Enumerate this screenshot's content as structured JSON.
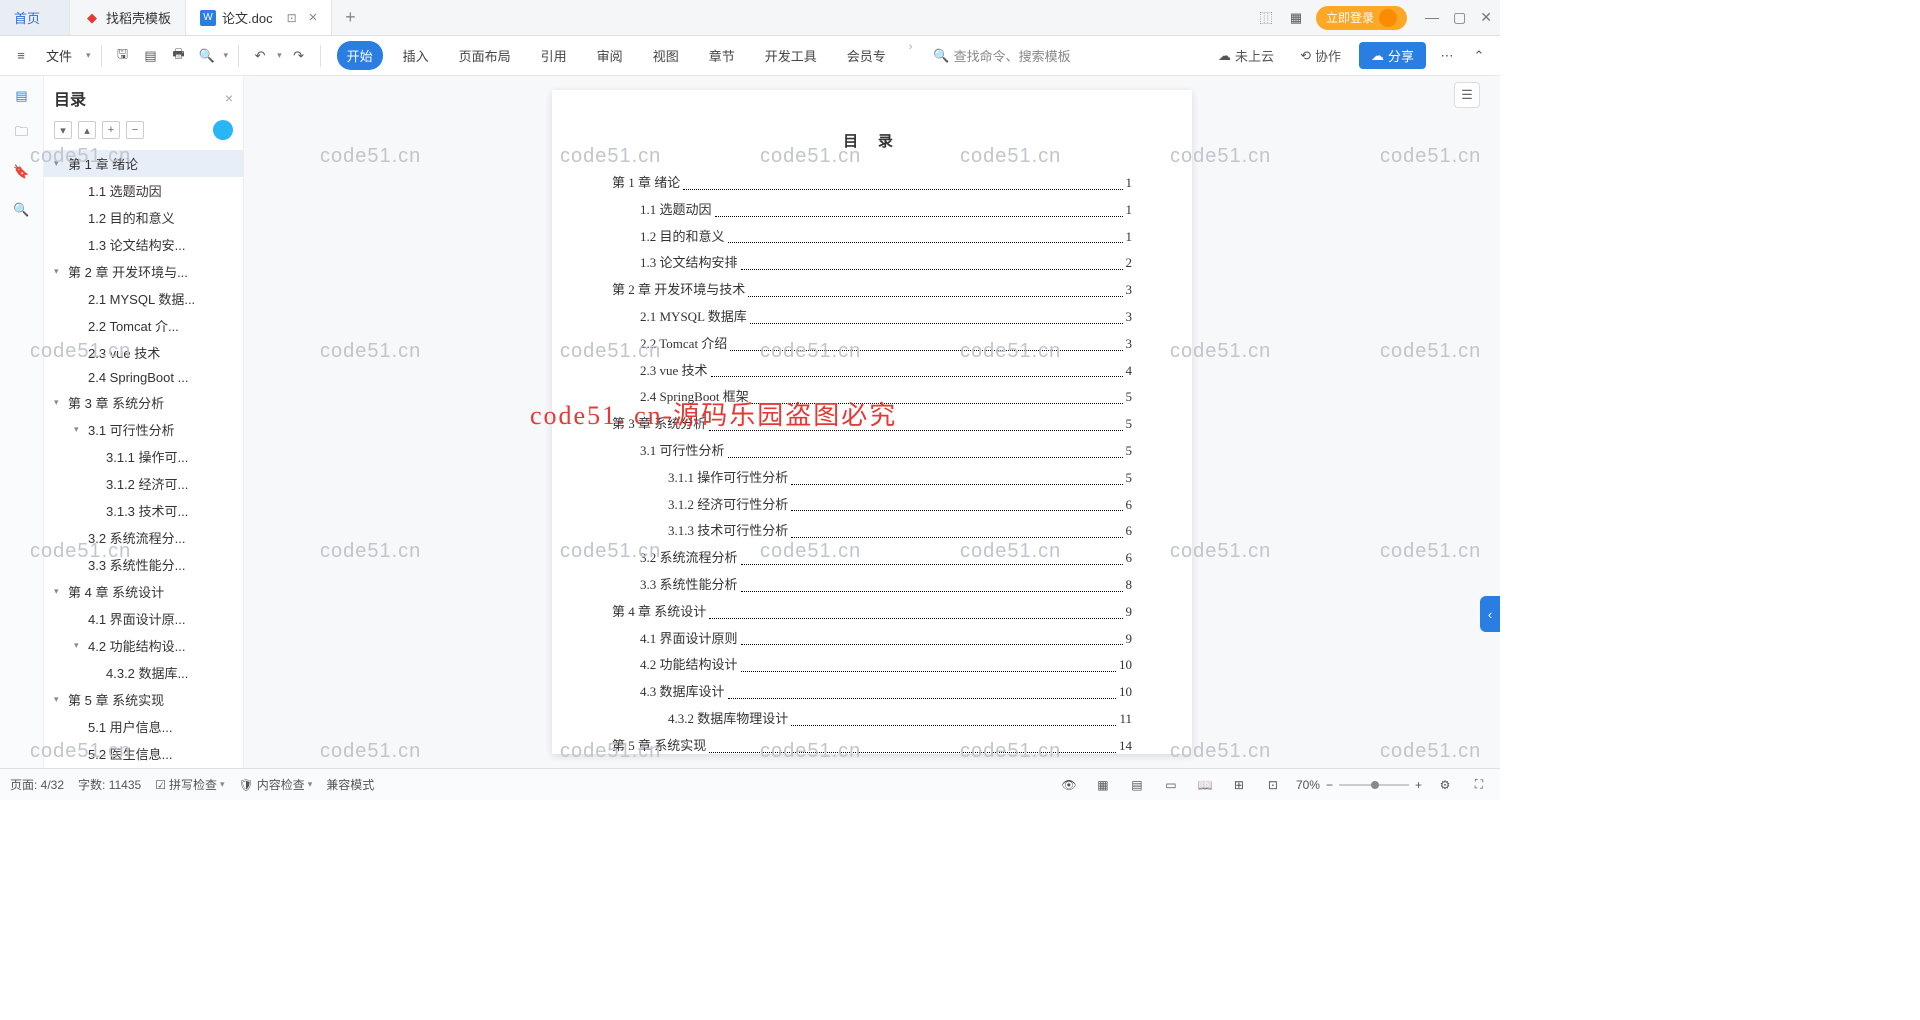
{
  "tabs": {
    "home": "首页",
    "t1": "找稻壳模板",
    "t2": "论文.doc"
  },
  "login_btn": "立即登录",
  "file_label": "文件",
  "menu": {
    "start": "开始",
    "insert": "插入",
    "layout": "页面布局",
    "ref": "引用",
    "review": "审阅",
    "view": "视图",
    "chapter": "章节",
    "devtools": "开发工具",
    "member": "会员专"
  },
  "search_cmd": "查找命令、搜索模板",
  "cloud": "未上云",
  "collab": "协作",
  "share": "分享",
  "toc_panel_title": "目录",
  "toc": [
    {
      "lvl": 0,
      "caret": "▾",
      "txt": "第 1 章  绪论",
      "sel": true
    },
    {
      "lvl": 1,
      "txt": "1.1 选题动因"
    },
    {
      "lvl": 1,
      "txt": "1.2 目的和意义"
    },
    {
      "lvl": 1,
      "txt": "1.3 论文结构安..."
    },
    {
      "lvl": 0,
      "caret": "▾",
      "txt": "第 2 章  开发环境与..."
    },
    {
      "lvl": 1,
      "txt": "2.1 MYSQL 数据..."
    },
    {
      "lvl": 1,
      "txt": "2.2 Tomcat  介..."
    },
    {
      "lvl": 1,
      "txt": "2.3 vue 技术"
    },
    {
      "lvl": 1,
      "txt": "2.4 SpringBoot ..."
    },
    {
      "lvl": 0,
      "caret": "▾",
      "txt": "第 3 章  系统分析"
    },
    {
      "lvl": 1,
      "caret": "▾",
      "txt": "3.1 可行性分析"
    },
    {
      "lvl": 2,
      "txt": "3.1.1 操作可..."
    },
    {
      "lvl": 2,
      "txt": "3.1.2 经济可..."
    },
    {
      "lvl": 2,
      "txt": "3.1.3 技术可..."
    },
    {
      "lvl": 1,
      "txt": "3.2 系统流程分..."
    },
    {
      "lvl": 1,
      "txt": "3.3 系统性能分..."
    },
    {
      "lvl": 0,
      "caret": "▾",
      "txt": "第 4 章  系统设计"
    },
    {
      "lvl": 1,
      "txt": "4.1 界面设计原..."
    },
    {
      "lvl": 1,
      "caret": "▾",
      "txt": "4.2 功能结构设..."
    },
    {
      "lvl": 2,
      "txt": "4.3.2  数据库..."
    },
    {
      "lvl": 0,
      "caret": "▾",
      "txt": "第 5 章  系统实现"
    },
    {
      "lvl": 1,
      "txt": "5.1 用户信息..."
    },
    {
      "lvl": 1,
      "txt": "5.2 医生信息..."
    }
  ],
  "doc_title": "目  录",
  "doc_toc": [
    {
      "lvl": 0,
      "txt": "第 1 章  绪论",
      "pg": "1"
    },
    {
      "lvl": 1,
      "txt": "1.1 选题动因",
      "pg": "1"
    },
    {
      "lvl": 1,
      "txt": "1.2 目的和意义",
      "pg": "1"
    },
    {
      "lvl": 1,
      "txt": "1.3 论文结构安排",
      "pg": "2"
    },
    {
      "lvl": 0,
      "txt": "第 2 章  开发环境与技术",
      "pg": "3"
    },
    {
      "lvl": 1,
      "txt": "2.1 MYSQL 数据库",
      "pg": "3"
    },
    {
      "lvl": 1,
      "txt": "2.2 Tomcat  介绍",
      "pg": "3"
    },
    {
      "lvl": 1,
      "txt": "2.3 vue 技术",
      "pg": "4"
    },
    {
      "lvl": 1,
      "txt": "2.4 SpringBoot 框架",
      "pg": "5"
    },
    {
      "lvl": 0,
      "txt": "第 3 章  系统分析",
      "pg": "5"
    },
    {
      "lvl": 1,
      "txt": "3.1 可行性分析",
      "pg": "5"
    },
    {
      "lvl": 2,
      "txt": "3.1.1 操作可行性分析",
      "pg": "5"
    },
    {
      "lvl": 2,
      "txt": "3.1.2 经济可行性分析",
      "pg": "6"
    },
    {
      "lvl": 2,
      "txt": "3.1.3 技术可行性分析",
      "pg": "6"
    },
    {
      "lvl": 1,
      "txt": "3.2 系统流程分析",
      "pg": "6"
    },
    {
      "lvl": 1,
      "txt": "3.3 系统性能分析",
      "pg": "8"
    },
    {
      "lvl": 0,
      "txt": "第 4 章  系统设计",
      "pg": "9"
    },
    {
      "lvl": 1,
      "txt": "4.1 界面设计原则",
      "pg": "9"
    },
    {
      "lvl": 1,
      "txt": "4.2 功能结构设计",
      "pg": "10"
    },
    {
      "lvl": 1,
      "txt": "4.3 数据库设计",
      "pg": "10"
    },
    {
      "lvl": 2,
      "txt": "4.3.2  数据库物理设计",
      "pg": "11"
    },
    {
      "lvl": 0,
      "txt": "第 5 章  系统实现",
      "pg": "14"
    }
  ],
  "status": {
    "page": "页面: 4/32",
    "words": "字数: 11435",
    "spell": "拼写检查",
    "content": "内容检查",
    "compat": "兼容模式",
    "zoom": "70%"
  },
  "watermark_grey": "code51.cn",
  "watermark_red": "code51. cn-源码乐园盗图必究"
}
